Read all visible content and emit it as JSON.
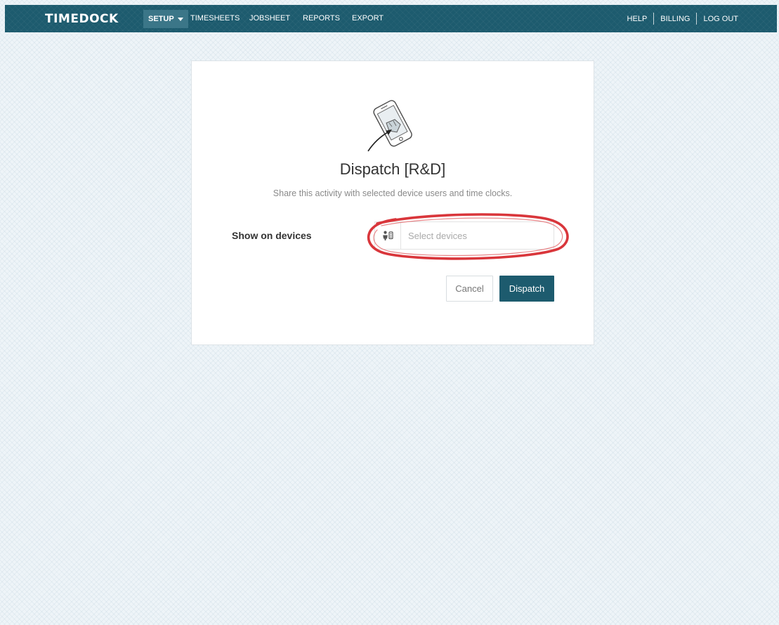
{
  "navbar": {
    "brand": "TIMEDOCK",
    "setup_label": "SETUP",
    "links": [
      "TIMESHEETS",
      "JOBSHEET",
      "REPORTS",
      "EXPORT"
    ],
    "right_links": [
      "HELP",
      "BILLING",
      "LOG OUT"
    ],
    "background_color": "#1d5b6e",
    "active_item_color": "#3b7688"
  },
  "dialog": {
    "illustration_icon": "phone-dispatch-icon",
    "title": "Dispatch [R&D]",
    "subtitle": "Share this activity with selected device users and time clocks.",
    "field_label": "Show on devices",
    "device_input": {
      "icon": "device-users-icon",
      "value": "",
      "placeholder": "Select devices"
    },
    "cancel_label": "Cancel",
    "dispatch_label": "Dispatch",
    "primary_color": "#1d5b6e",
    "highlight_color": "#d9363b"
  }
}
